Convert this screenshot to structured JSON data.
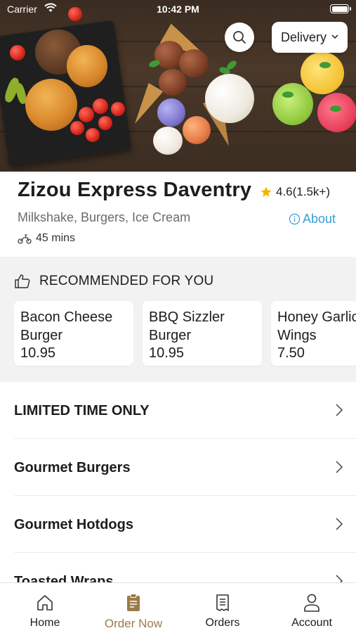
{
  "status_bar": {
    "carrier": "Carrier",
    "time": "10:42 PM"
  },
  "header": {
    "search_icon": "search-icon",
    "delivery_label": "Delivery"
  },
  "restaurant": {
    "name": "Zizou Express Daventry",
    "rating": "4.6(1.5k+)",
    "cuisines": "Milkshake, Burgers, Ice Cream",
    "about_label": "About",
    "delivery_time": "45 mins"
  },
  "recommended": {
    "title": "RECOMMENDED FOR YOU",
    "items": [
      {
        "name_line1": "Bacon Cheese",
        "name_line2": "Burger",
        "price": "10.95"
      },
      {
        "name_line1": "BBQ Sizzler",
        "name_line2": "Burger",
        "price": "10.95"
      },
      {
        "name_line1": "Honey Garlic",
        "name_line2": "Wings",
        "price": "7.50"
      }
    ]
  },
  "categories": [
    "LIMITED TIME ONLY",
    "Gourmet Burgers",
    "Gourmet Hotdogs",
    "Toasted Wraps"
  ],
  "tabbar": {
    "tabs": [
      {
        "label": "Home",
        "icon": "home-icon"
      },
      {
        "label": "Order Now",
        "icon": "order-icon"
      },
      {
        "label": "Orders",
        "icon": "receipt-icon"
      },
      {
        "label": "Account",
        "icon": "account-icon"
      }
    ],
    "active": "Order Now"
  },
  "colors": {
    "accent": "#9a7b48",
    "link": "#3a9fd5",
    "star": "#f4b400",
    "section_bg": "#f2f2f2"
  }
}
